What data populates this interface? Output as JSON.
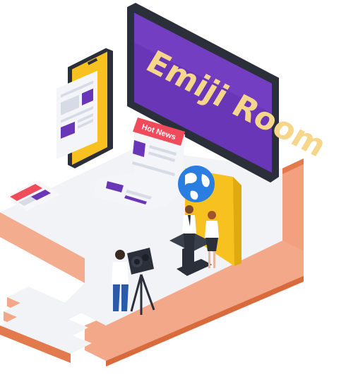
{
  "tv": {
    "title": "Emiji Room"
  },
  "newspaper": {
    "tag": "Hot News"
  },
  "icons": [
    "globe-icon",
    "news-camera-icon",
    "smartphone-icon",
    "newspaper-icon"
  ],
  "colors": {
    "platform_top": "#f1f3f6",
    "platform_side": "#f4a98a",
    "platform_edge": "#d86a3c",
    "screen_purple": "#6a36b8",
    "screen_frame": "#2b2f3a",
    "accent_red": "#ef4b5a",
    "accent_yellow": "#f7c21f",
    "globe_blue": "#2a7de1"
  }
}
